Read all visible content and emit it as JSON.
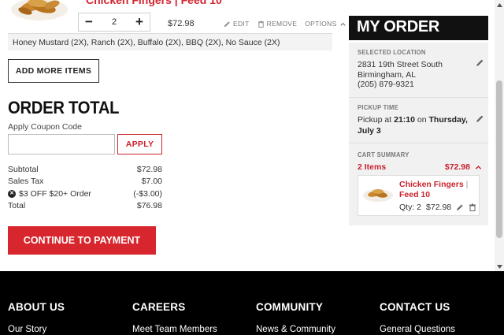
{
  "cart_item": {
    "title": "Chicken Fingers | Feed 10",
    "quantity": "2",
    "price": "$72.98",
    "edit_label": "EDIT",
    "remove_label": "REMOVE",
    "options_label": "OPTIONS",
    "sauces": "Honey Mustard (2X), Ranch (2X), Buffalo (2X), BBQ (2X), No Sauce (2X)"
  },
  "add_more_label": "ADD MORE ITEMS",
  "order_total": {
    "title": "ORDER TOTAL",
    "coupon_label": "Apply Coupon Code",
    "coupon_value": "",
    "apply_label": "APPLY",
    "rows": [
      {
        "label": "Subtotal",
        "value": "$72.98"
      },
      {
        "label": "Sales Tax",
        "value": "$7.00"
      },
      {
        "label": "$3 OFF $20+ Order",
        "value": "(-$3.00)"
      },
      {
        "label": "Total",
        "value": "$76.98"
      }
    ],
    "continue_label": "CONTINUE TO PAYMENT"
  },
  "my_order": {
    "title": "MY ORDER",
    "location_label": "SELECTED LOCATION",
    "address_line1": "2831 19th Street South",
    "address_line2": "Birmingham, AL",
    "phone": "(205) 879-9321",
    "pickup_label": "PICKUP TIME",
    "pickup_prefix": "Pickup at",
    "pickup_time": "21:10",
    "pickup_on": "on",
    "pickup_date": "Thursday, July 3",
    "cart_label": "CART SUMMARY",
    "items_count": "2 Items",
    "cart_total": "$72.98",
    "card_name_1": "Chicken Fingers",
    "card_sep": "|",
    "card_name_2": "Feed 10",
    "card_qty": "Qty: 2",
    "card_price": "$72.98"
  },
  "footer": {
    "columns": [
      {
        "heading": "ABOUT US",
        "link": "Our Story"
      },
      {
        "heading": "CAREERS",
        "link": "Meet Team Members"
      },
      {
        "heading": "COMMUNITY",
        "link": "News & Community"
      },
      {
        "heading": "CONTACT US",
        "link": "General Questions"
      }
    ]
  },
  "colors": {
    "brand_red": "#d7262e",
    "black": "#111111",
    "panel_grey": "#f1f1f1"
  },
  "icons": [
    "pencil-icon",
    "trash-icon",
    "chevron-up-icon",
    "close-circle-icon",
    "food-thumbnail"
  ]
}
